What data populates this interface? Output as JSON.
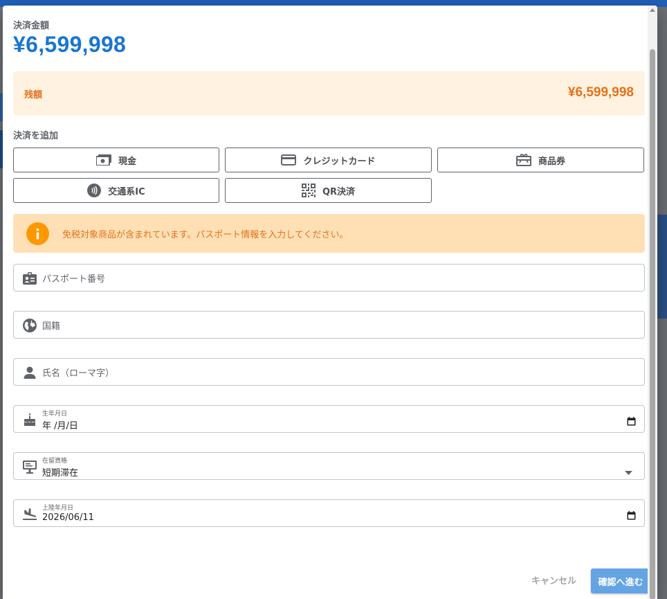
{
  "amount": {
    "label": "決済金額",
    "value": "¥6,599,998"
  },
  "balance": {
    "label": "残額",
    "value": "¥6,599,998"
  },
  "add_payment": {
    "label": "決済を追加",
    "methods": [
      {
        "label": "現金",
        "icon": "cash-icon"
      },
      {
        "label": "クレジットカード",
        "icon": "credit-card-icon"
      },
      {
        "label": "商品券",
        "icon": "gift-card-icon"
      },
      {
        "label": "交通系IC",
        "icon": "contactless-icon"
      },
      {
        "label": "QR決済",
        "icon": "qr-code-icon"
      }
    ]
  },
  "notice": {
    "text": "免税対象商品が含まれています。パスポート情報を入力してください。"
  },
  "form": {
    "passport": {
      "placeholder": "パスポート番号"
    },
    "nationality": {
      "placeholder": "国籍"
    },
    "name": {
      "placeholder": "氏名（ローマ字）"
    },
    "birthdate": {
      "label": "生年月日",
      "value": "年 /月/日"
    },
    "residence": {
      "label": "在留資格",
      "value": "短期滞在"
    },
    "landing": {
      "label": "上陸年月日",
      "value": "2026/06/11"
    }
  },
  "footer": {
    "cancel": "キャンセル",
    "confirm": "確認へ進む"
  },
  "colors": {
    "accent": "#1976d2",
    "warning": "#e5711b",
    "warning_bg": "#ffe0b5",
    "balance_bg": "#fff2e0",
    "confirm_bg": "#64a4e3"
  }
}
